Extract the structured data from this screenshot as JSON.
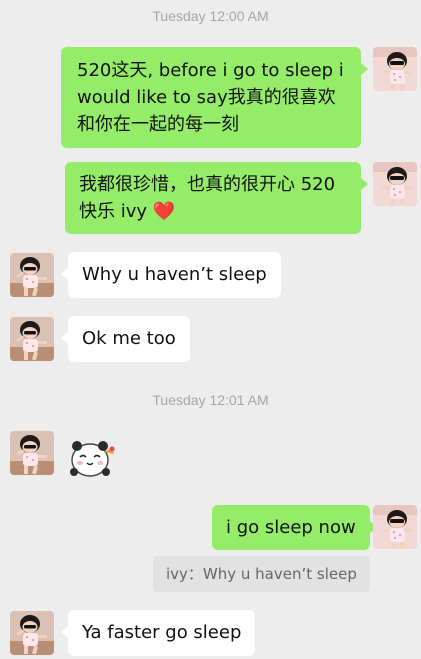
{
  "chat": {
    "timestamp_1": "Tuesday 12:00 AM",
    "timestamp_2": "Tuesday 12:01 AM",
    "messages": [
      {
        "from": "me",
        "text": "520这天, before i go to sleep i would like to say我真的很喜欢和你在一起的每一刻"
      },
      {
        "from": "me",
        "text": "我都很珍惜，也真的很开心 520 快乐 ivy",
        "emoji": "❤️",
        "emoji_name": "red-heart"
      },
      {
        "from": "them",
        "text": "Why u haven’t sleep"
      },
      {
        "from": "them",
        "text": "Ok me too"
      },
      {
        "from": "them",
        "sticker": "panda-sticker"
      },
      {
        "from": "me",
        "text": "i go sleep now",
        "quote": "ivy：Why u haven’t sleep"
      },
      {
        "from": "them",
        "text": "Ya faster go sleep"
      }
    ]
  },
  "colors": {
    "background": "#ededed",
    "my_bubble": "#95ec69",
    "their_bubble": "#ffffff",
    "quote_bg": "#e2e2e2",
    "timestamp": "#a6a6a6"
  },
  "avatars": {
    "me": "sunglasses-girl-avatar",
    "them": "dancing-girl-avatar"
  }
}
